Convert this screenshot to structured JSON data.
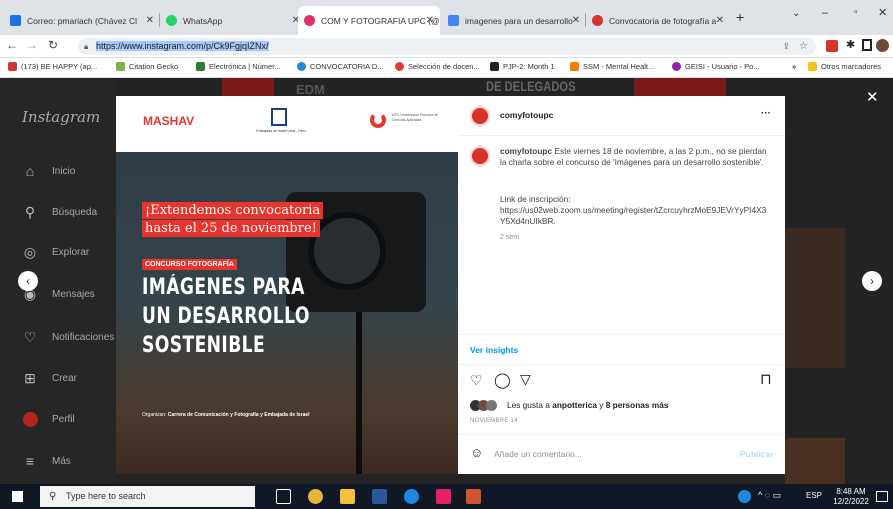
{
  "tabs": [
    {
      "title": "Correo: pmariach (Chávez Cl",
      "color": "#1a73e8"
    },
    {
      "title": "WhatsApp",
      "color": "#25d366"
    },
    {
      "title": "COM Y FOTOGRAFIA UPC (@",
      "color": "#e1306c",
      "active": true
    },
    {
      "title": "imagenes para un desarrollo",
      "color": "#4285f4"
    },
    {
      "title": "Convocatoria de fotografía a",
      "color": "#d8332a"
    }
  ],
  "address": {
    "url": "https://www.instagram.com/p/Ck9FgjqIZNx/"
  },
  "bookmarks": [
    "(173) BE HAPPY (ap...",
    "Citation Gecko",
    "Electrónica | Númer...",
    "CONVOCATORIA D...",
    "Selección de docen...",
    "PJP-2: Month 1",
    "SSM - Mental Healt...",
    "GEISI - Usuario - Po...",
    "»",
    "Otros marcadores"
  ],
  "sidebar": {
    "logo": "Instagram",
    "items": [
      {
        "label": "Inicio",
        "icon": "home-icon",
        "glyph": "⌂"
      },
      {
        "label": "Búsqueda",
        "icon": "search-icon",
        "glyph": "⚲"
      },
      {
        "label": "Explorar",
        "icon": "explore-icon",
        "glyph": "◎"
      },
      {
        "label": "Mensajes",
        "icon": "messenger-icon",
        "glyph": "◉"
      },
      {
        "label": "Notificaciones",
        "icon": "heart-icon",
        "glyph": "♡"
      },
      {
        "label": "Crear",
        "icon": "create-icon",
        "glyph": "⊞"
      },
      {
        "label": "Perfil",
        "icon": "avatar",
        "glyph": ""
      },
      {
        "label": "Más",
        "icon": "menu-icon",
        "glyph": "≡"
      }
    ]
  },
  "background_text": {
    "left": "EDM",
    "right": "DE DELEGADOS"
  },
  "post_image": {
    "logo_left": "MASHAV",
    "logo_mid": "Embajada de Israel Lima - Perú",
    "logo_right": "UPC Universidad Peruana de Ciencias Aplicadas",
    "banner1": "¡Extendemos convocatoria",
    "banner2": "hasta el 25 de noviembre!",
    "tag": "CONCURSO FOTOGRAFÍA",
    "headline": [
      "IMÁGENES PARA",
      "UN DESARROLLO",
      "SOSTENIBLE"
    ],
    "organizers_label": "Organizan:",
    "organizers": "Carrera de Comunicación y Fotografía y Embajada de Israel"
  },
  "panel": {
    "username": "comyfotoupc",
    "more": "···",
    "caption_user": "comyfotoupc",
    "caption": "Este viernes 18 de noviembre, a las 2 p.m., no se pierdan la charla sobre el concurso de 'Imágenes para un desarrollo sostenible'.",
    "link_label": "Link de inscripción:",
    "link": "https://us02web.zoom.us/meeting/register/tZcrcuyhrzMoE9JEVrYyPI4X3Y5Xd4nUIkBR.",
    "time": "2 sem",
    "insights": "Ver insights",
    "likes_prefix": "Les gusta a ",
    "likes_user": "anpotterica",
    "likes_mid": " y ",
    "likes_count": "8 personas más",
    "date": "NOVIEMBRE 14",
    "comment_placeholder": "Añade un comentario...",
    "publish": "Publicar"
  },
  "close": "✕",
  "prev": "‹",
  "next": "›",
  "taskbar": {
    "search": "Type here to search",
    "lang": "ESP",
    "time": "8:48 AM",
    "date": "12/2/2022"
  },
  "colors": {
    "ig_blue": "#0095f6",
    "upc_red": "#e8342d"
  }
}
